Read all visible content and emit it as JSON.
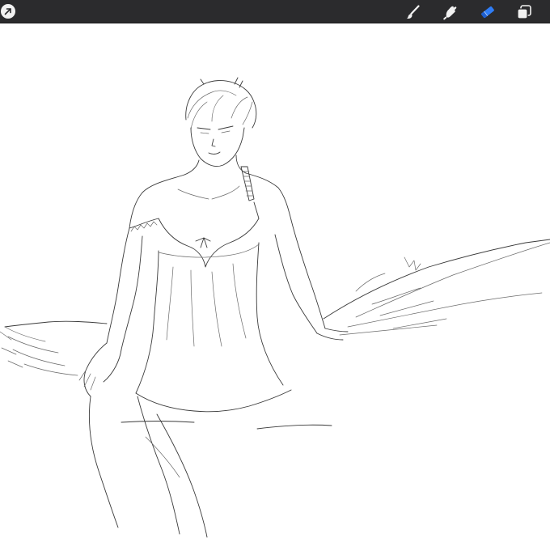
{
  "app": {
    "name": "drawing-app"
  },
  "toolbar": {
    "actions_icon": "arrow-icon",
    "tools": [
      {
        "id": "brush",
        "icon": "brush-icon",
        "active": false
      },
      {
        "id": "smudge",
        "icon": "smudge-icon",
        "active": false
      },
      {
        "id": "eraser",
        "icon": "eraser-icon",
        "active": true
      },
      {
        "id": "layers",
        "icon": "layers-icon",
        "active": false
      }
    ],
    "colors": {
      "bar": "#2b2b2d",
      "icon": "#f2f2f2",
      "active": "#2f7df6"
    }
  },
  "canvas": {
    "background": "#ffffff",
    "content": "pencil-sketch"
  }
}
